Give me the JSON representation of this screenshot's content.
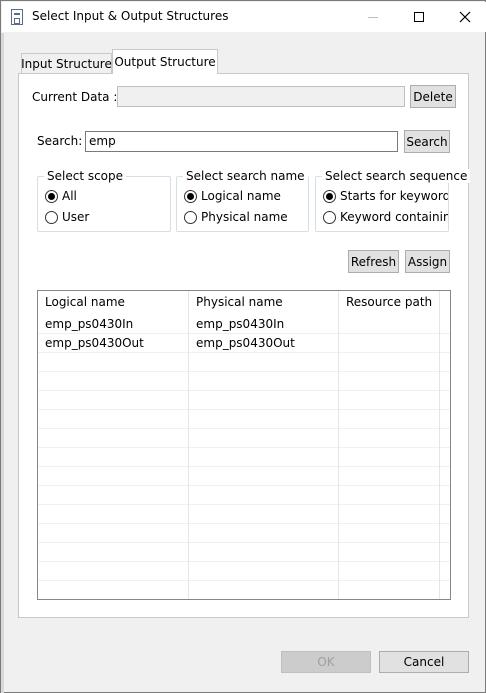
{
  "window": {
    "title": "Select Input & Output Structures"
  },
  "tabs": [
    {
      "label": "Input Structure",
      "active": false
    },
    {
      "label": "Output Structure",
      "active": true
    }
  ],
  "current_data": {
    "label": "Current Data :",
    "value": "",
    "delete_label": "Delete"
  },
  "search": {
    "label": "Search:",
    "value": "emp",
    "button_label": "Search"
  },
  "scope": {
    "title": "Select scope",
    "options": [
      {
        "label": "All",
        "checked": true
      },
      {
        "label": "User",
        "checked": false
      }
    ]
  },
  "search_name": {
    "title": "Select search name",
    "options": [
      {
        "label": "Logical name",
        "checked": true
      },
      {
        "label": "Physical name",
        "checked": false
      }
    ]
  },
  "search_sequence": {
    "title": "Select search sequence",
    "options": [
      {
        "label": "Starts for keyword",
        "checked": true
      },
      {
        "label": "Keyword containing",
        "checked": false
      }
    ]
  },
  "actions": {
    "refresh_label": "Refresh",
    "assign_label": "Assign"
  },
  "table": {
    "columns": [
      "Logical name",
      "Physical name",
      "Resource path"
    ],
    "rows": [
      [
        "emp_ps0430In",
        "emp_ps0430In",
        ""
      ],
      [
        "emp_ps0430Out",
        "emp_ps0430Out",
        ""
      ]
    ]
  },
  "footer": {
    "ok_label": "OK",
    "cancel_label": "Cancel"
  },
  "colors": {
    "border": "#7a7a7a",
    "button_bg": "#e1e1e1",
    "disabled_bg": "#cccccc"
  }
}
